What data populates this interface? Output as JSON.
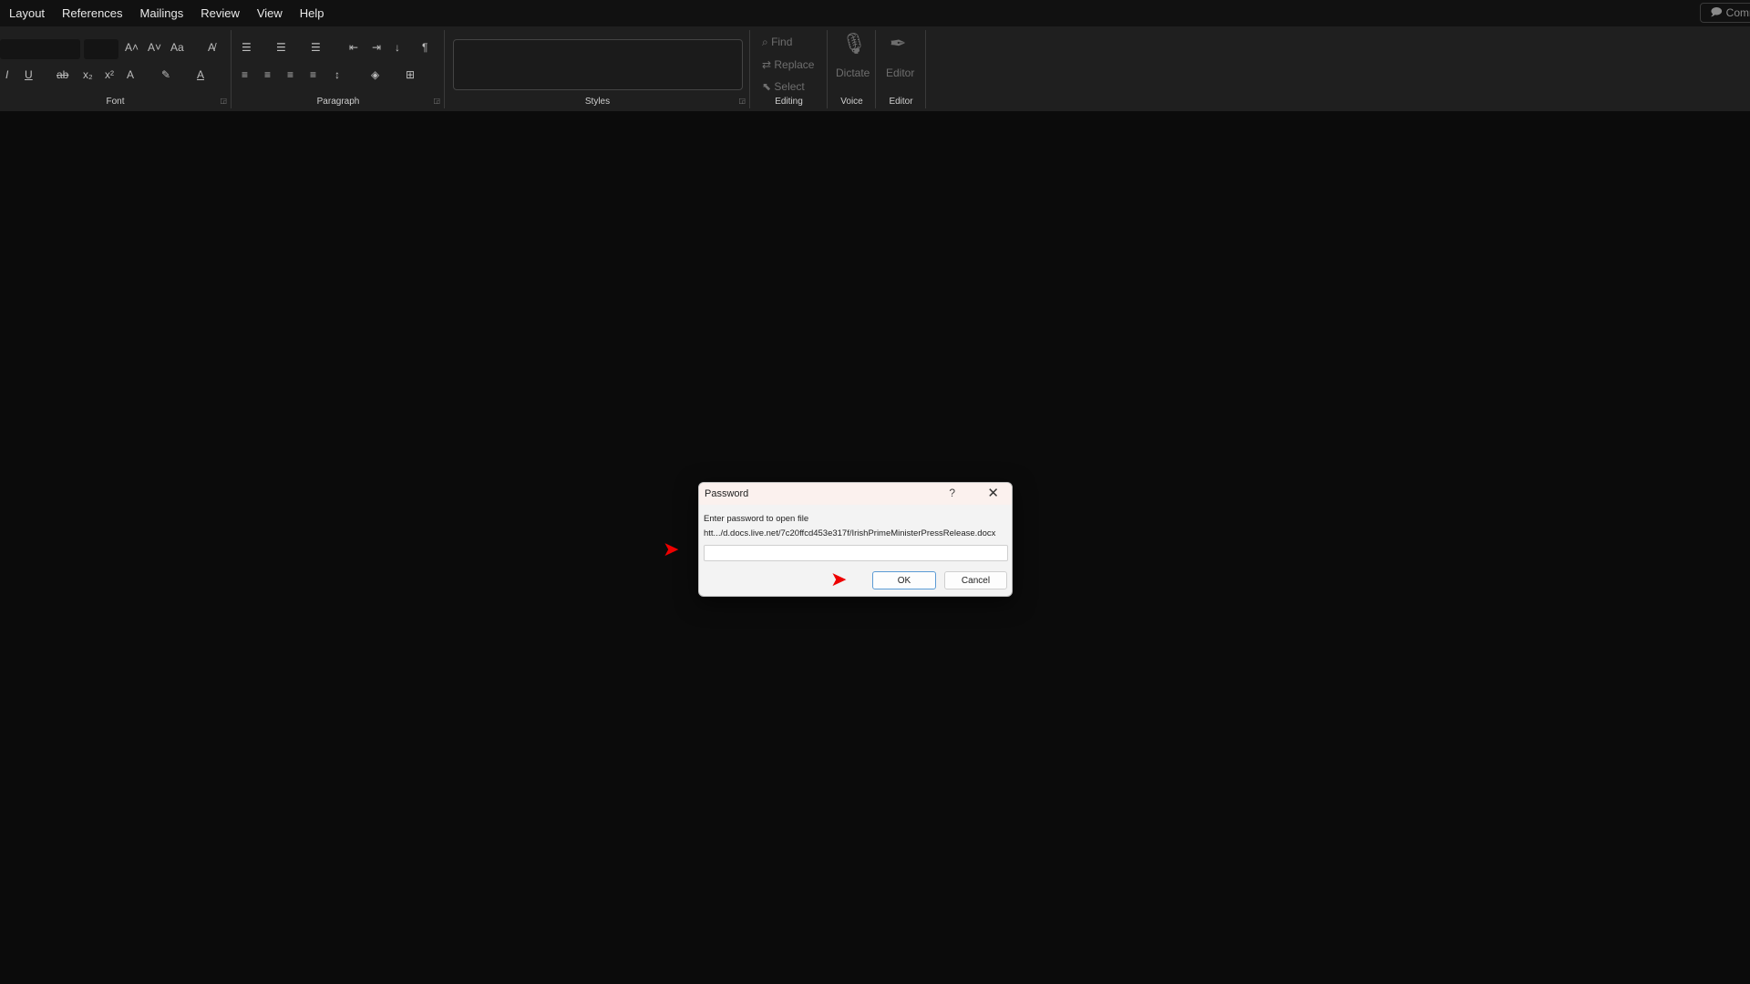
{
  "menubar": {
    "items": [
      "Layout",
      "References",
      "Mailings",
      "Review",
      "View",
      "Help"
    ],
    "comments_label": "Comm"
  },
  "ribbon": {
    "groups": {
      "font": "Font",
      "paragraph": "Paragraph",
      "styles": "Styles",
      "editing": "Editing",
      "voice": "Voice",
      "editor": "Editor"
    },
    "editing": {
      "find": "Find",
      "replace": "Replace",
      "select": "Select"
    },
    "voice": {
      "dictate": "Dictate"
    },
    "editor": {
      "editor": "Editor"
    }
  },
  "dialog": {
    "title": "Password",
    "help": "?",
    "close": "✕",
    "prompt": "Enter password to open file",
    "path": "htt.../d.docs.live.net/7c20ffcd453e317f/IrishPrimeMinisterPressRelease.docx",
    "ok_label": "OK",
    "cancel_label": "Cancel"
  },
  "annotations": {
    "arrow_glyph": "➤",
    "arrow_color": "#e00000",
    "note": "Red arrows overlaid on the screenshot pointing at the password field and OK button"
  }
}
